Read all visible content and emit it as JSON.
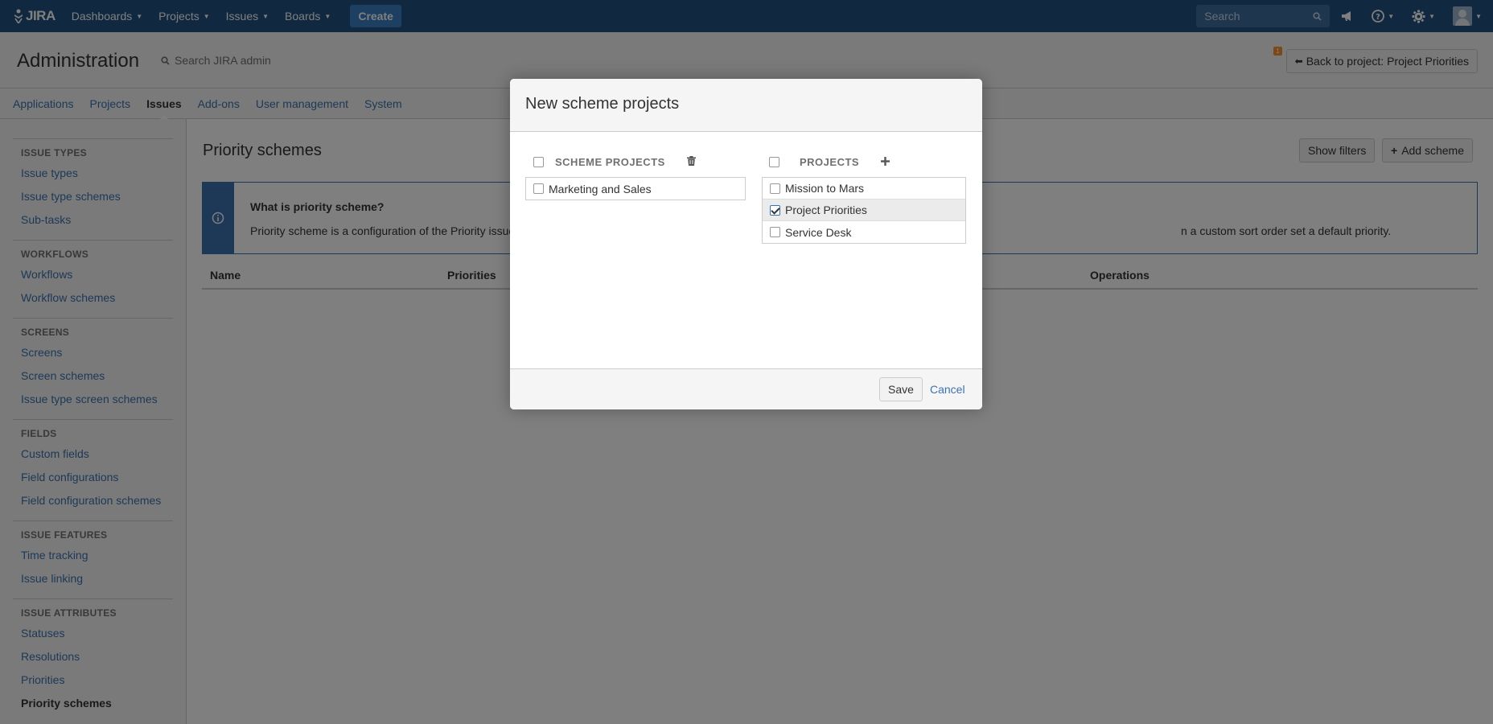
{
  "nav": {
    "logo": "JIRA",
    "items": [
      {
        "label": "Dashboards"
      },
      {
        "label": "Projects"
      },
      {
        "label": "Issues"
      },
      {
        "label": "Boards"
      }
    ],
    "create_label": "Create",
    "search_placeholder": "Search",
    "icons": [
      "search-icon",
      "notifications-icon",
      "help-icon",
      "settings-icon",
      "user-avatar"
    ]
  },
  "admin": {
    "title": "Administration",
    "search_label": "Search JIRA admin",
    "back_button": "Back to project: Project Priorities",
    "notification_count": "1",
    "tabs": [
      {
        "label": "Applications"
      },
      {
        "label": "Projects"
      },
      {
        "label": "Issues"
      },
      {
        "label": "Add-ons"
      },
      {
        "label": "User management"
      },
      {
        "label": "System"
      }
    ]
  },
  "sidebar": {
    "sections": [
      {
        "heading": "ISSUE TYPES",
        "links": [
          "Issue types",
          "Issue type schemes",
          "Sub-tasks"
        ]
      },
      {
        "heading": "WORKFLOWS",
        "links": [
          "Workflows",
          "Workflow schemes"
        ]
      },
      {
        "heading": "SCREENS",
        "links": [
          "Screens",
          "Screen schemes",
          "Issue type screen schemes"
        ]
      },
      {
        "heading": "FIELDS",
        "links": [
          "Custom fields",
          "Field configurations",
          "Field configuration schemes"
        ]
      },
      {
        "heading": "ISSUE FEATURES",
        "links": [
          "Time tracking",
          "Issue linking"
        ]
      },
      {
        "heading": "ISSUE ATTRIBUTES",
        "links": [
          "Statuses",
          "Resolutions",
          "Priorities",
          "Priority schemes"
        ]
      }
    ]
  },
  "main": {
    "title": "Priority schemes",
    "show_filters": "Show filters",
    "add_scheme": "Add scheme",
    "info_title": "What is priority scheme?",
    "info_text_start": "Priority scheme is a configuration of the Priority issue",
    "info_text_end": "n a custom sort order set a default priority.",
    "columns": [
      "Name",
      "Priorities",
      "Operations"
    ]
  },
  "dialog": {
    "title": "New scheme projects",
    "left_header": "SCHEME PROJECTS",
    "right_header": "PROJECTS",
    "scheme_projects": [
      {
        "label": "Marketing and Sales",
        "checked": false
      }
    ],
    "projects": [
      {
        "label": "Mission to Mars",
        "checked": false
      },
      {
        "label": "Project Priorities",
        "checked": true
      },
      {
        "label": "Service Desk",
        "checked": false
      }
    ],
    "save_label": "Save",
    "cancel_label": "Cancel"
  }
}
